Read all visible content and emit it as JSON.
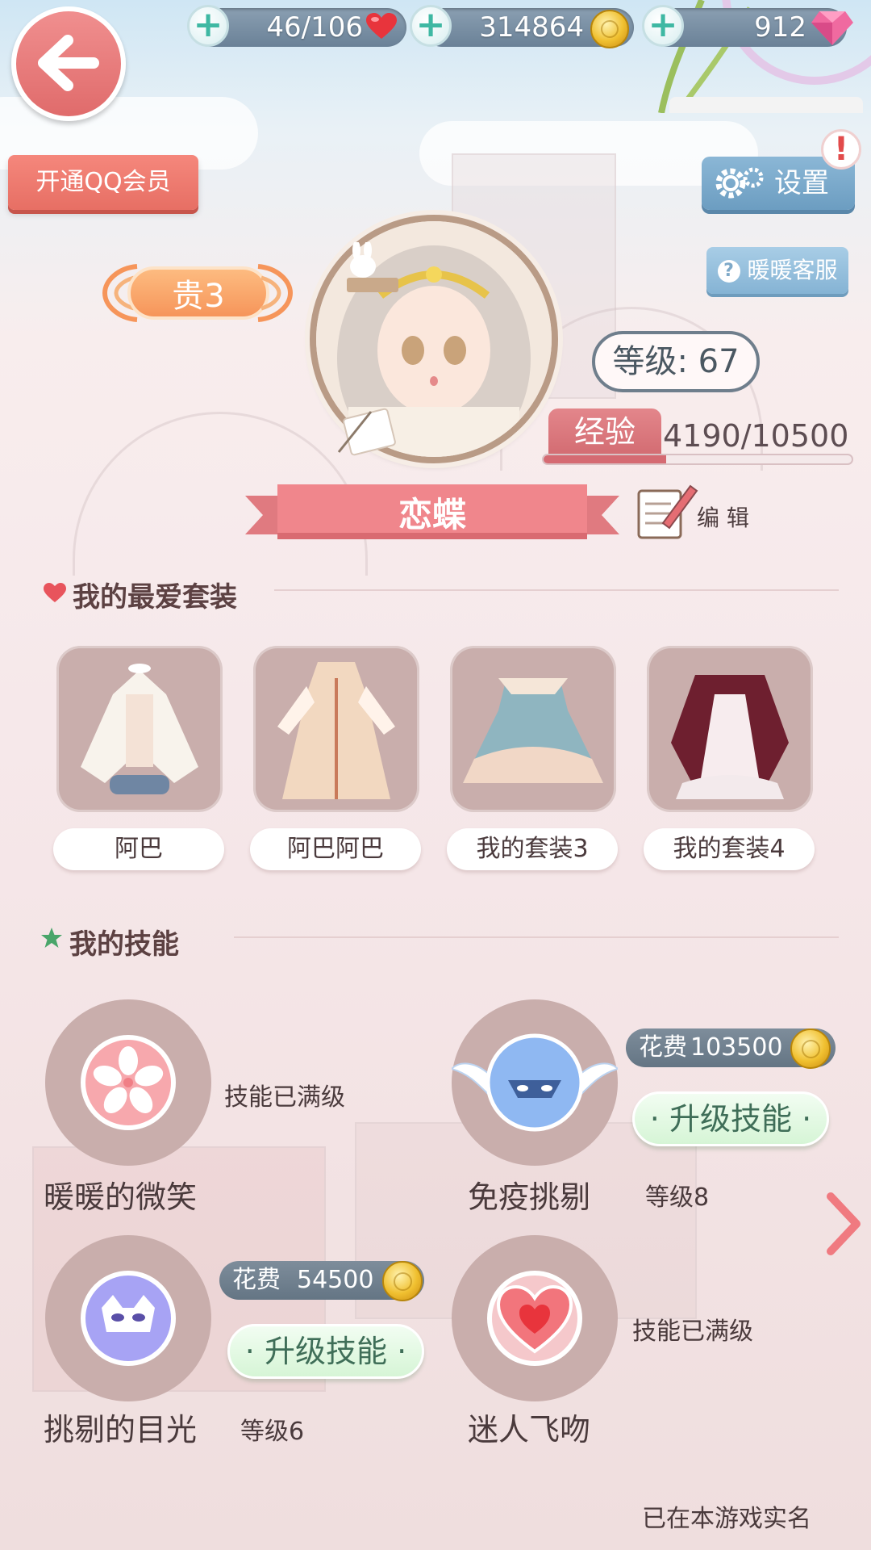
{
  "resources": {
    "stamina": "46/106",
    "gold": "314864",
    "diamonds": "912",
    "icons": [
      "plus-icon",
      "heart-icon",
      "coin-icon",
      "gem-icon"
    ]
  },
  "header": {
    "qq_member_label": "开通QQ会员",
    "settings_label": "设置",
    "alert_mark": "!",
    "service_label": "暖暖客服",
    "service_icon_char": "?"
  },
  "profile": {
    "vip_label": "贵3",
    "level_label": "等级: 67",
    "exp_label": "经验",
    "exp_value": "4190/10500",
    "exp_fraction": 0.399,
    "nickname": "恋蝶",
    "edit_label": "编 辑"
  },
  "favorites": {
    "title": "我的最爱套装",
    "items": [
      {
        "label": "阿巴"
      },
      {
        "label": "阿巴阿巴"
      },
      {
        "label": "我的套装3"
      },
      {
        "label": "我的套装4"
      }
    ]
  },
  "skills": {
    "title": "我的技能",
    "items": [
      {
        "name": "暖暖的微笑",
        "status": "技能已满级",
        "icon": "sakura-icon"
      },
      {
        "name": "免疫挑剔",
        "cost_label": "花费",
        "cost": "103500",
        "upgrade_label": "升级技能",
        "level": "等级8",
        "icon": "winged-mask-icon"
      },
      {
        "name": "挑剔的目光",
        "cost_label": "花费",
        "cost": "54500",
        "upgrade_label": "升级技能",
        "level": "等级6",
        "icon": "cat-mask-icon"
      },
      {
        "name": "迷人飞吻",
        "status": "技能已满级",
        "icon": "heart-icon"
      }
    ]
  },
  "footer": {
    "realname_text": "已在本游戏实名"
  },
  "colors": {
    "accent_red": "#e06b6b",
    "accent_blue": "#6c9dc1",
    "card_bg": "#c9aeac",
    "upgrade_green": "#d6f5d6"
  }
}
